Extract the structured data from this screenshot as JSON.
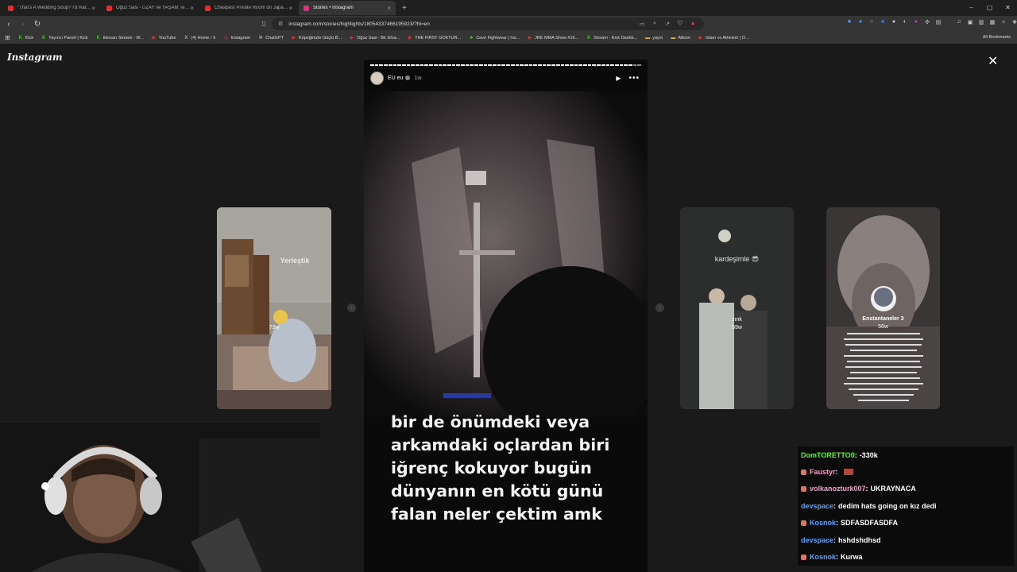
{
  "tabs": [
    {
      "title": "\"That's A Wedding Soup? I'd Rather...",
      "fav_color": "#e03030",
      "active": false
    },
    {
      "title": "Oğuz Sasi - UZAY ve YAŞAM Teorileri",
      "fav_color": "#e03030",
      "active": false
    },
    {
      "title": "Cheapest Private Room on Japan's C...",
      "fav_color": "#e03030",
      "active": false
    },
    {
      "title": "Stories • Instagram",
      "fav_color": "#d6347a",
      "active": true
    }
  ],
  "new_tab": "+",
  "window_controls": [
    "–",
    "▢",
    "✕"
  ],
  "address": {
    "url": "instagram.com/stories/highlights/18054337466195923/?hl=en"
  },
  "bookmarks": [
    {
      "label": "Kick",
      "color": "#53fc18",
      "glyph": "K"
    },
    {
      "label": "Yayıncı Paneli | Kick",
      "color": "#53fc18",
      "glyph": "K"
    },
    {
      "label": "Ikinsan Stream - W...",
      "color": "#53fc18",
      "glyph": "K"
    },
    {
      "label": "YouTube",
      "color": "#e03030",
      "glyph": "▶"
    },
    {
      "label": "(4) Home / X",
      "color": "#dddddd",
      "glyph": "X"
    },
    {
      "label": "Instagram",
      "color": "#d6347a",
      "glyph": "◎"
    },
    {
      "label": "ChatGPT",
      "color": "#cccccc",
      "glyph": "✲"
    },
    {
      "label": "Köpeğinizle Güçlü B...",
      "color": "#e03030",
      "glyph": "▶"
    },
    {
      "label": "Oğuz Sasi - Bir Efsa...",
      "color": "#e03030",
      "glyph": "▶"
    },
    {
      "label": "THE FIRST GOKTUR...",
      "color": "#e03030",
      "glyph": "▶"
    },
    {
      "label": "Cave Fightwear | Ins...",
      "color": "#53c018",
      "glyph": "♣"
    },
    {
      "label": "JRE MMA Show #16...",
      "color": "#e03030",
      "glyph": "▶"
    },
    {
      "label": "Stream - Kick Dashb...",
      "color": "#53fc18",
      "glyph": "K"
    },
    {
      "label": "yayın",
      "color": "#e0b040",
      "glyph": "▬"
    },
    {
      "label": "Albüm",
      "color": "#e0b040",
      "glyph": "▬"
    },
    {
      "label": "Islam vs Atheism | O...",
      "color": "#e03030",
      "glyph": "▶"
    }
  ],
  "all_bookmarks": "All Bookmarks",
  "instagram": {
    "logo": "Instagram",
    "close": "✕"
  },
  "story": {
    "username": "EU eu",
    "time_ago": "1w",
    "play": "▶",
    "more": "•••",
    "segments_total": 60,
    "segments_done": 58,
    "caption_lines": [
      "bir de önümdeki veya",
      "arkamdaki oçlardan biri",
      "iğrenç kokuyor bugün",
      "dünyanın en kötü günü",
      "falan neler çektim amk"
    ]
  },
  "thumbs": {
    "left": {
      "overlay_text": "Yerleştik",
      "time": "73w"
    },
    "right1": {
      "overlay_text": "kardeşimle 😎",
      "name": "zınk",
      "time": "59w"
    },
    "right2": {
      "name": "Enstantaneler 3",
      "time": "56w"
    }
  },
  "arrows": {
    "prev": "‹",
    "next": "›"
  },
  "chat": [
    {
      "user": "DomTORETTO0",
      "color": "#53fc18",
      "msg": "-330k",
      "badge": false,
      "emote": false
    },
    {
      "user": "Faustyr",
      "color": "#f2a0c8",
      "msg": "",
      "badge": true,
      "emote": true
    },
    {
      "user": "volkanozturk007",
      "color": "#f2a0c8",
      "msg": "UKRAYNACA",
      "badge": true,
      "emote": false
    },
    {
      "user": "devspace",
      "color": "#5aa0ff",
      "msg": "dedim hats going on kız dedi",
      "badge": false,
      "emote": false
    },
    {
      "user": "Kosnok",
      "color": "#5aa0ff",
      "msg": "SDFASDFASDFA",
      "badge": true,
      "emote": false
    },
    {
      "user": "devspace",
      "color": "#5aa0ff",
      "msg": "hshdshdhsd",
      "badge": false,
      "emote": false
    },
    {
      "user": "Kosnok",
      "color": "#5aa0ff",
      "msg": "Kurwa",
      "badge": true,
      "emote": false
    }
  ]
}
